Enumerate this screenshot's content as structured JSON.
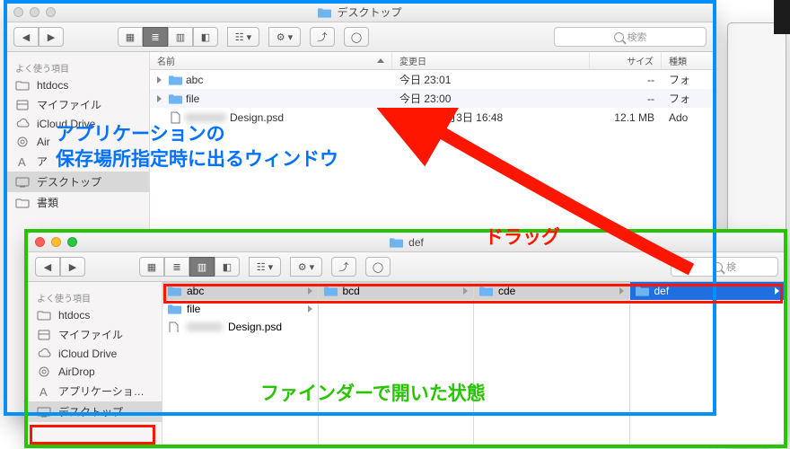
{
  "annotations": {
    "top_text_l1": "アプリケーションの",
    "top_text_l2": "保存場所指定時に出るウィンドウ",
    "drag_label": "ドラッグ",
    "bottom_text": "ファインダーで開いた状態"
  },
  "top_window": {
    "title": "デスクトップ",
    "search_placeholder": "検索",
    "sidebar_header": "よく使う項目",
    "sidebar": [
      {
        "label": "htdocs",
        "icon": "folder"
      },
      {
        "label": "マイファイル",
        "icon": "myfiles"
      },
      {
        "label": "iCloud Drive",
        "icon": "cloud"
      },
      {
        "label": "Air",
        "icon": "airdrop",
        "cut": true
      },
      {
        "label": "ア",
        "icon": "apps",
        "cut": true
      },
      {
        "label": "デスクトップ",
        "icon": "desktop",
        "selected": true
      },
      {
        "label": "書類",
        "icon": "folder",
        "cut": true
      }
    ],
    "columns": {
      "name": "名前",
      "date": "変更日",
      "size": "サイズ",
      "kind": "種類"
    },
    "rows": [
      {
        "name": "abc",
        "expander": true,
        "date": "今日 23:01",
        "size": "--",
        "kind": "フォ"
      },
      {
        "name": "file",
        "expander": true,
        "date": "今日 23:00",
        "size": "--",
        "kind": "フォ"
      },
      {
        "name": "Design.psd",
        "blurprefix": true,
        "date": "2015年11月3日 16:48",
        "size": "12.1 MB",
        "kind": "Ado"
      }
    ]
  },
  "bottom_window": {
    "title": "def",
    "search_placeholder": "検",
    "sidebar_header": "よく使う項目",
    "sidebar": [
      {
        "label": "htdocs",
        "icon": "folder"
      },
      {
        "label": "マイファイル",
        "icon": "myfiles"
      },
      {
        "label": "iCloud Drive",
        "icon": "cloud"
      },
      {
        "label": "AirDrop",
        "icon": "airdrop"
      },
      {
        "label": "アプリケーショ…",
        "icon": "apps"
      },
      {
        "label": "デスクトップ",
        "icon": "desktop",
        "selected": true
      }
    ],
    "cols": [
      {
        "items": [
          {
            "label": "abc",
            "sel": true
          },
          {
            "label": "file"
          },
          {
            "label": "Design.psd",
            "blurprefix": true,
            "file": true
          }
        ]
      },
      {
        "items": [
          {
            "label": "bcd",
            "sel": true
          }
        ]
      },
      {
        "items": [
          {
            "label": "cde",
            "sel": true
          }
        ]
      },
      {
        "items": [
          {
            "label": "def",
            "blue": true
          }
        ]
      }
    ]
  }
}
